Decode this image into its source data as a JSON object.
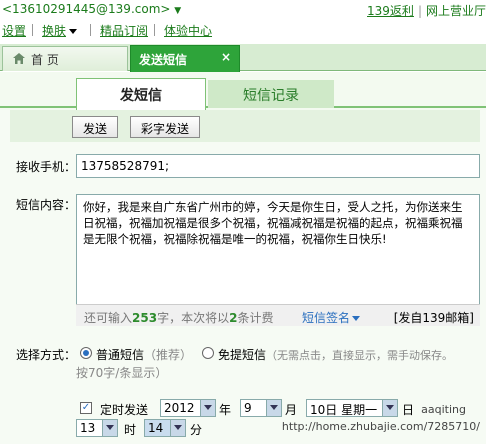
{
  "header": {
    "email": "<13610291445@139.com>",
    "email_caret": "▼",
    "link_fanli": "139返利",
    "link_business": "网上营业厅"
  },
  "menu": {
    "settings": "设置",
    "skin": "换肤",
    "subscription": "精品订阅",
    "experience": "体验中心"
  },
  "tabs": {
    "home": "首 页",
    "send_sms": "发送短信",
    "close": "×"
  },
  "subtabs": {
    "send": "发短信",
    "records": "短信记录"
  },
  "toolbar": {
    "send": "发送",
    "color_send": "彩字发送"
  },
  "form": {
    "recipient_label": "接收手机：",
    "recipient_value": "13758528791;",
    "content_label": "短信内容：",
    "content_value": "你好，我是来自广东省广州市的婷，今天是你生日，受人之托，为你送来生日祝福，祝福加祝福是很多个祝福，祝福减祝福是祝福的起点，祝福乘祝福是无限个祝福，祝福除祝福是唯一的祝福，祝福你生日快乐!",
    "counter_prefix": "还可输入",
    "counter_remaining": "253",
    "counter_mid": "字，本次将以",
    "counter_parts": "2",
    "counter_suffix": "条计费",
    "signature": "短信签名",
    "signer": "[发自139邮箱]",
    "mode_label": "选择方式：",
    "mode_normal": "普通短信",
    "mode_normal_note": "（推荐）",
    "mode_flash": "免提短信",
    "mode_flash_note": "（无需点击，直接显示，需手动保存。",
    "mode_flash_note2": "按70字/条显示）",
    "timed_label": "定时发送",
    "year": "2012",
    "year_unit": "年",
    "month": "9",
    "month_unit": "月",
    "day": "10日 星期一",
    "day_unit": "日",
    "hour": "13",
    "hour_unit": "时",
    "minute": "14",
    "minute_unit": "分"
  },
  "watermark": {
    "user": "aaqiting",
    "url": "http://home.zhubajie.com/7285710/"
  },
  "colors": {
    "green_tab": "#2ea43a",
    "link_green": "#1b7b1b",
    "accent_blue": "#2a6fbf"
  }
}
